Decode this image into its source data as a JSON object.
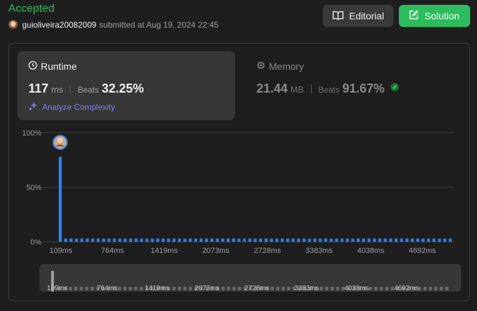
{
  "header": {
    "status": "Accepted",
    "username": "guioliveira20082009",
    "submitted_text": "submitted at Aug 19, 2024 22:45",
    "editorial_label": "Editorial",
    "solution_label": "Solution"
  },
  "runtime": {
    "label": "Runtime",
    "value": "117",
    "unit": "ms",
    "beats_label": "Beats",
    "beats_pct": "32.25%",
    "analyze_label": "Analyze Complexity"
  },
  "memory": {
    "label": "Memory",
    "value": "21.44",
    "unit": "MB",
    "beats_label": "Beats",
    "beats_pct": "91.67%"
  },
  "colors": {
    "accent_green": "#2cbb5d",
    "bar_blue": "#2f7ef5",
    "analyze_purple": "#7d7ef8"
  },
  "chart_data": {
    "type": "bar",
    "title": "",
    "xlabel": "",
    "ylabel": "",
    "ylim": [
      0,
      100
    ],
    "y_ticks": [
      "0%",
      "50%",
      "100%"
    ],
    "x_tick_labels": [
      "109ms",
      "764ms",
      "1419ms",
      "2073ms",
      "2728ms",
      "3383ms",
      "4038ms",
      "4692ms"
    ],
    "values": [
      78,
      3,
      3,
      3,
      3,
      3,
      3,
      3,
      3,
      3,
      3,
      3,
      3,
      3,
      3,
      3,
      3,
      3,
      3,
      3,
      3,
      3,
      3,
      3,
      3,
      3,
      3,
      3,
      3,
      3,
      3,
      3,
      3,
      3,
      3,
      3,
      3,
      3,
      3,
      3,
      3,
      3,
      3,
      3,
      3,
      3,
      3,
      3,
      3,
      3,
      3,
      3,
      3,
      3,
      3,
      3,
      3,
      3,
      3,
      3,
      3,
      3,
      3,
      3,
      3,
      3,
      3,
      3,
      3,
      3,
      3,
      3,
      3
    ],
    "highlight_index": 0,
    "grid": true
  }
}
